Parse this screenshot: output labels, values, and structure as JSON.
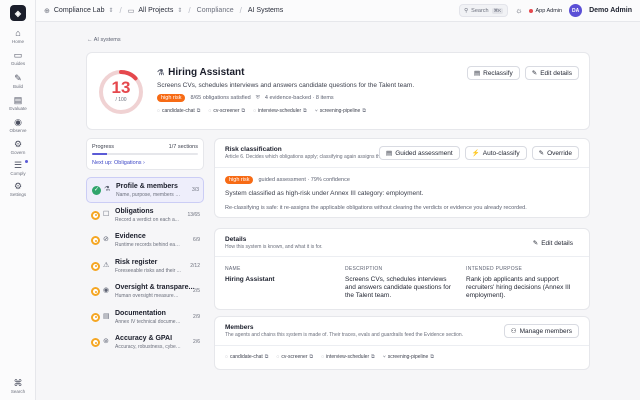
{
  "rail": {
    "items": [
      {
        "label": "Home",
        "icon": "⌂"
      },
      {
        "label": "Guides",
        "icon": "▭"
      },
      {
        "label": "Build",
        "icon": "✎"
      },
      {
        "label": "Evaluate",
        "icon": "▤"
      },
      {
        "label": "Observe",
        "icon": "◉"
      },
      {
        "label": "Govern",
        "icon": "⚙"
      },
      {
        "label": "Comply",
        "icon": "☰"
      },
      {
        "label": "Settings",
        "icon": "⚙"
      }
    ],
    "search_label": "Search",
    "logo": "◈"
  },
  "topbar": {
    "org": "Compliance Lab",
    "project": "All Projects",
    "crumb1": "Compliance",
    "crumb2": "AI Systems",
    "search_placeholder": "Search",
    "search_kbd": "⌘K",
    "app_admin": "App Admin",
    "avatar": "DA",
    "user": "Demo Admin"
  },
  "back_link": "← AI systems",
  "hero": {
    "score": "13",
    "score_sub": "/ 100",
    "score_fraction": 0.13,
    "title": "Hiring Assistant",
    "description": "Screens CVs, schedules interviews and answers candidate questions for the Talent team.",
    "risk_badge": "high risk",
    "obligations": "8/65 obligations satisfied",
    "evidence": "4 evidence-backed · 8 items",
    "chips": [
      "candidate-chat",
      "cv-screener",
      "interview-scheduler",
      "screening-pipeline"
    ],
    "reclassify": "Reclassify",
    "edit": "Edit details"
  },
  "progress": {
    "label": "Progress",
    "count": "1/7 sections",
    "fraction": 0.143,
    "next": "Next up: Obligations ›"
  },
  "sections": [
    {
      "title": "Profile & members",
      "sub": "Name, purpose, members an...",
      "count": "3/3",
      "icon": "⚗",
      "status": "done"
    },
    {
      "title": "Obligations",
      "sub": "Record a verdict on each a...",
      "count": "13/65",
      "icon": "☐",
      "status": "todo"
    },
    {
      "title": "Evidence",
      "sub": "Runtime records behind each...",
      "count": "6/9",
      "icon": "⊘",
      "status": "todo"
    },
    {
      "title": "Risk register",
      "sub": "Foreseeable risks and their ...",
      "count": "2/12",
      "icon": "⚠",
      "status": "todo"
    },
    {
      "title": "Oversight & transpare...",
      "sub": "Human oversight measures a...",
      "count": "2/5",
      "icon": "◉",
      "status": "todo"
    },
    {
      "title": "Documentation",
      "sub": "Annex IV technical document...",
      "count": "2/9",
      "icon": "▤",
      "status": "todo"
    },
    {
      "title": "Accuracy & GPAI",
      "sub": "Accuracy, robustness, cybers...",
      "count": "2/6",
      "icon": "⊚",
      "status": "todo"
    }
  ],
  "risk": {
    "title": "Risk classification",
    "sub": "Article 6. Decides which obligations apply; classifying again assigns them.",
    "btn_guided": "Guided assessment",
    "btn_auto": "Auto-classify",
    "btn_override": "Override",
    "badge": "high risk",
    "confidence": "guided assessment · 79% confidence",
    "classified": "System classified as high-risk under Annex III category: employment.",
    "note": "Re-classifying is safe: it re-assigns the applicable obligations without clearing the verdicts or evidence you already recorded."
  },
  "details": {
    "title": "Details",
    "sub": "How this system is known, and what it is for.",
    "edit": "Edit details",
    "name_h": "NAME",
    "name_v": "Hiring Assistant",
    "desc_h": "DESCRIPTION",
    "desc_v": "Screens CVs, schedules interviews and answers candidate questions for the Talent team.",
    "purpose_h": "INTENDED PURPOSE",
    "purpose_v": "Rank job applicants and support recruiters' hiring decisions (Annex III employment)."
  },
  "members": {
    "title": "Members",
    "sub": "The agents and chains this system is made of. Their traces, evals and guardrails feed the Evidence section.",
    "btn": "Manage members",
    "chips": [
      "candidate-chat",
      "cv-screener",
      "interview-scheduler",
      "screening-pipeline"
    ]
  },
  "colors": {
    "accent": "#5b5bd6",
    "risk": "#f76b15",
    "danger": "#e5484d",
    "success": "#30a46c",
    "warning": "#f5a623"
  }
}
